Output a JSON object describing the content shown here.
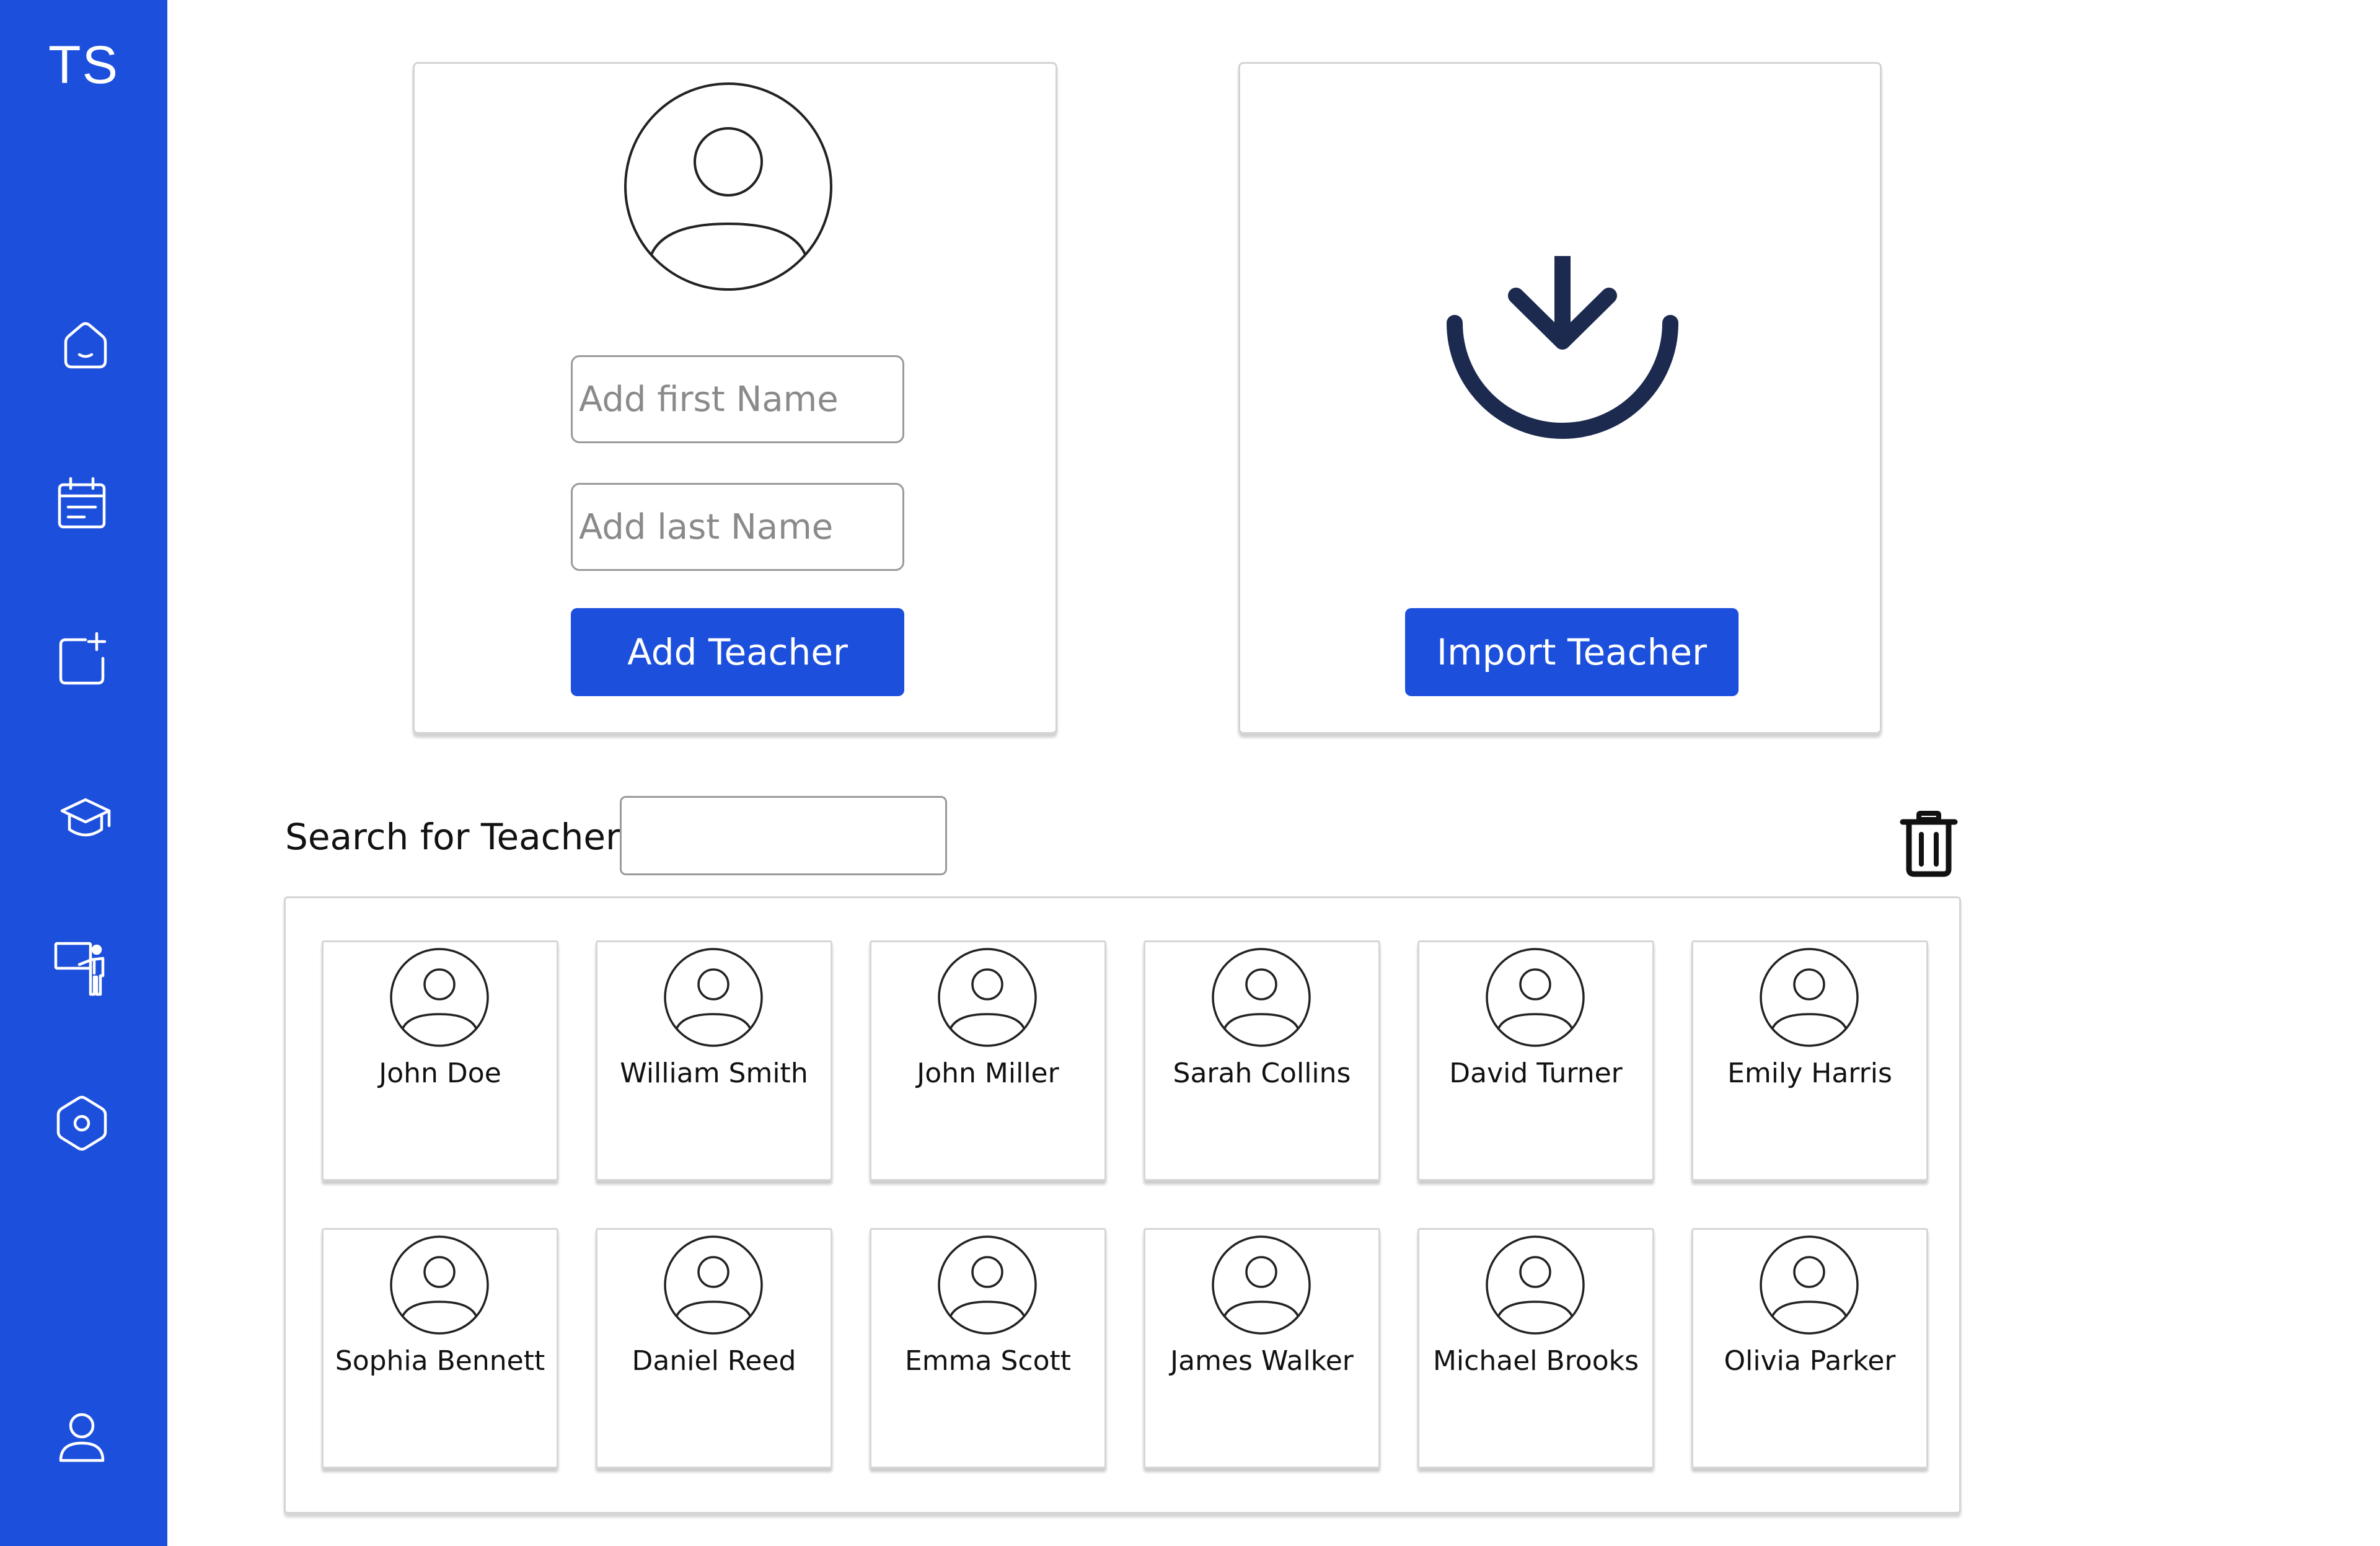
{
  "sidebar": {
    "logo": "TS",
    "items": [
      {
        "icon": "home-icon"
      },
      {
        "icon": "calendar-icon"
      },
      {
        "icon": "add-note-icon"
      },
      {
        "icon": "graduation-cap-icon"
      },
      {
        "icon": "teacher-presentation-icon"
      },
      {
        "icon": "settings-icon"
      },
      {
        "icon": "user-profile-icon"
      }
    ],
    "color": "#1c4fdb"
  },
  "add_teacher": {
    "avatar_icon": "user-avatar-icon",
    "first_name_placeholder": "Add first Name",
    "last_name_placeholder": "Add last Name",
    "button_label": "Add Teacher"
  },
  "import_teacher": {
    "icon": "download-icon",
    "button_label": "Import Teacher"
  },
  "search": {
    "label": "Search for Teacher:",
    "value": ""
  },
  "delete": {
    "icon": "trash-icon"
  },
  "teachers": [
    {
      "name": "John Doe"
    },
    {
      "name": "William Smith"
    },
    {
      "name": "John Miller"
    },
    {
      "name": "Sarah Collins"
    },
    {
      "name": "David Turner"
    },
    {
      "name": "Emily Harris"
    },
    {
      "name": "Sophia Bennett"
    },
    {
      "name": "Daniel Reed"
    },
    {
      "name": "Emma Scott"
    },
    {
      "name": "James Walker"
    },
    {
      "name": "Michael Brooks"
    },
    {
      "name": "Olivia Parker"
    }
  ]
}
